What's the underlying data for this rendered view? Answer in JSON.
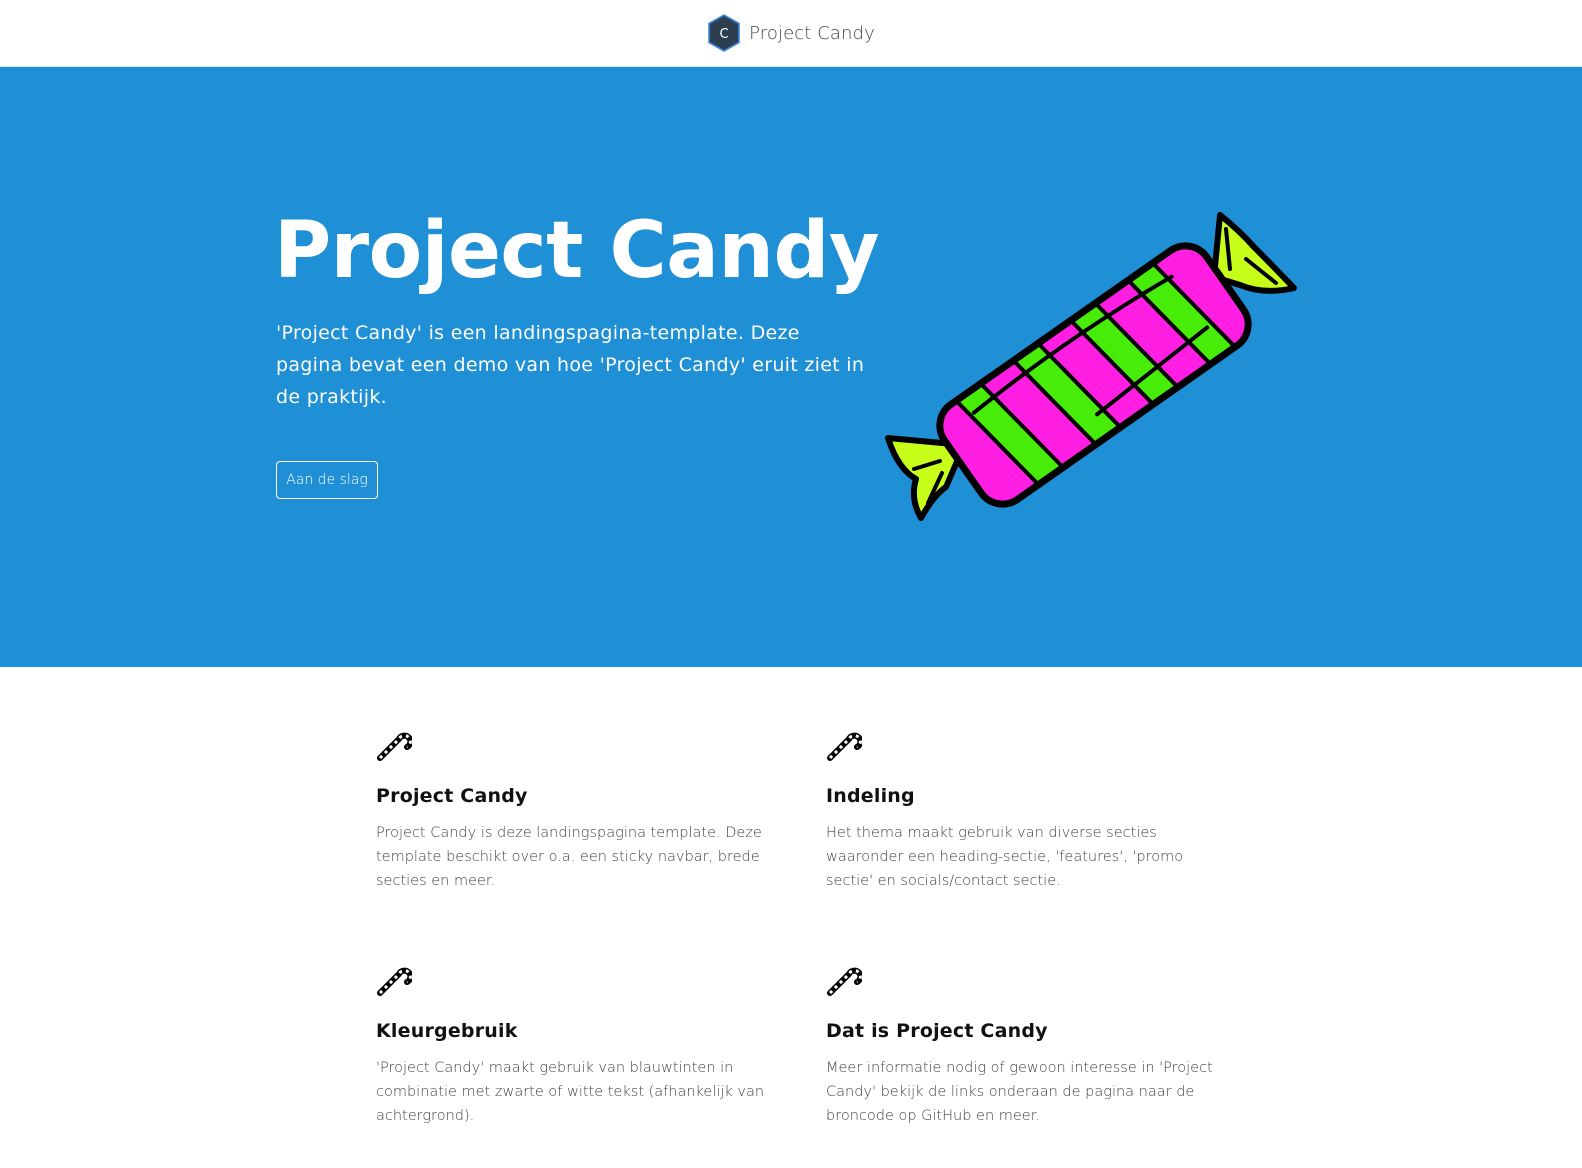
{
  "navbar": {
    "logo_letter": "C",
    "brand_name": "Project Candy"
  },
  "hero": {
    "title": "Project Candy",
    "text": "'Project Candy' is een landingspagina-template. Deze pagina bevat een demo van hoe 'Project Candy' eruit ziet in de praktijk.",
    "button_label": "Aan de slag",
    "illustration": "candy-wrapper-illustration"
  },
  "features": [
    {
      "icon": "candy-cane-icon",
      "title": "Project Candy",
      "text": "Project Candy is deze landingspagina template. Deze template beschikt over o.a. een sticky navbar, brede secties en meer."
    },
    {
      "icon": "candy-cane-icon",
      "title": "Indeling",
      "text": "Het thema maakt gebruik van diverse secties waaronder een heading-sectie, 'features', 'promo sectie' en socials/contact sectie."
    },
    {
      "icon": "candy-cane-icon",
      "title": "Kleurgebruik",
      "text": "'Project Candy' maakt gebruik van blauwtinten in combinatie met zwarte of witte tekst (afhankelijk van achtergrond)."
    },
    {
      "icon": "candy-cane-icon",
      "title": "Dat is Project Candy",
      "text": "Meer informatie nodig of gewoon interesse in 'Project Candy' bekijk de links onderaan de pagina naar de broncode op GitHub en meer."
    }
  ],
  "colors": {
    "hero_background": "#1f8fd6",
    "candy_pink": "#ff1ee1",
    "candy_green": "#48ec09",
    "candy_wrap": "#c8ff1a",
    "logo_fill": "#2c3e50"
  }
}
